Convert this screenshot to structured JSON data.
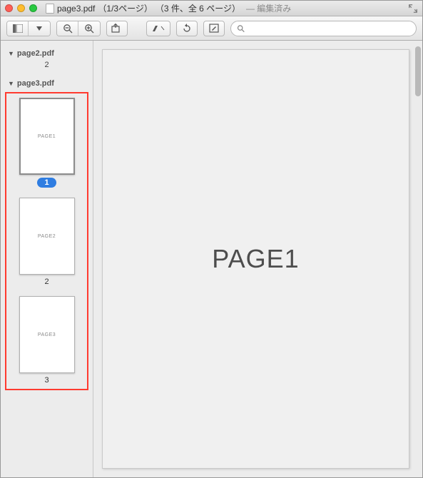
{
  "titlebar": {
    "filename": "page3.pdf",
    "page_info": "（1/3ページ）",
    "doc_info": "（3 件、全 6 ページ）",
    "edited": "— 編集済み"
  },
  "sidebar": {
    "group1": {
      "name": "page2.pdf",
      "stray_page_num": "2"
    },
    "group2": {
      "name": "page3.pdf",
      "thumbs": [
        {
          "label": "PAGE1",
          "num": "1",
          "selected": true
        },
        {
          "label": "PAGE2",
          "num": "2",
          "selected": false
        },
        {
          "label": "PAGE3",
          "num": "3",
          "selected": false
        }
      ]
    }
  },
  "viewer": {
    "content": "PAGE1"
  },
  "search": {
    "placeholder": ""
  }
}
